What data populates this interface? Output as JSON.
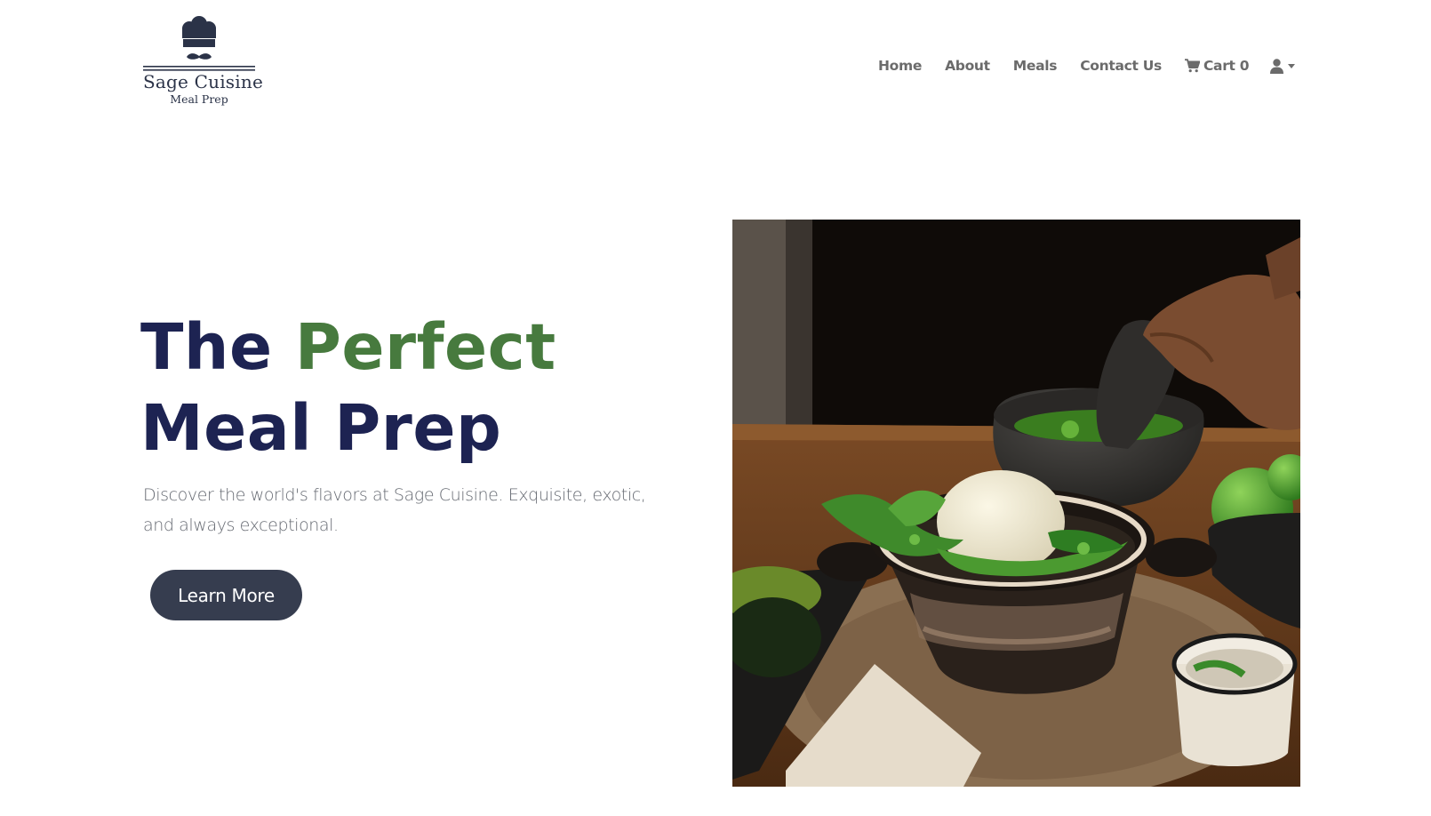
{
  "brand": {
    "name": "Sage Cuisine",
    "tagline": "Meal Prep",
    "logo_icon": "chef-hat-mustache-icon",
    "color": "#2b3348"
  },
  "nav": {
    "items": [
      {
        "label": "Home"
      },
      {
        "label": "About"
      },
      {
        "label": "Meals"
      },
      {
        "label": "Contact Us"
      }
    ],
    "cart_label": "Cart 0",
    "cart_icon": "cart-icon",
    "user_icon": "user-icon",
    "dropdown_icon": "caret-down-icon"
  },
  "hero": {
    "title_part1": "The ",
    "title_accent": "Perfect",
    "title_part2": " Meal Prep",
    "description": "Discover the world's flavors at Sage Cuisine. Exquisite, exotic, and always exceptional.",
    "cta_label": "Learn More",
    "image_subject": "molcajete with salsa ingredients, cheese, cilantro, limes and peppers on a wooden table"
  },
  "colors": {
    "title": "#1d2352",
    "accent": "#477a3e",
    "button": "#363d4f",
    "nav_text": "#6b6b6b",
    "body_text": "#666a72"
  }
}
